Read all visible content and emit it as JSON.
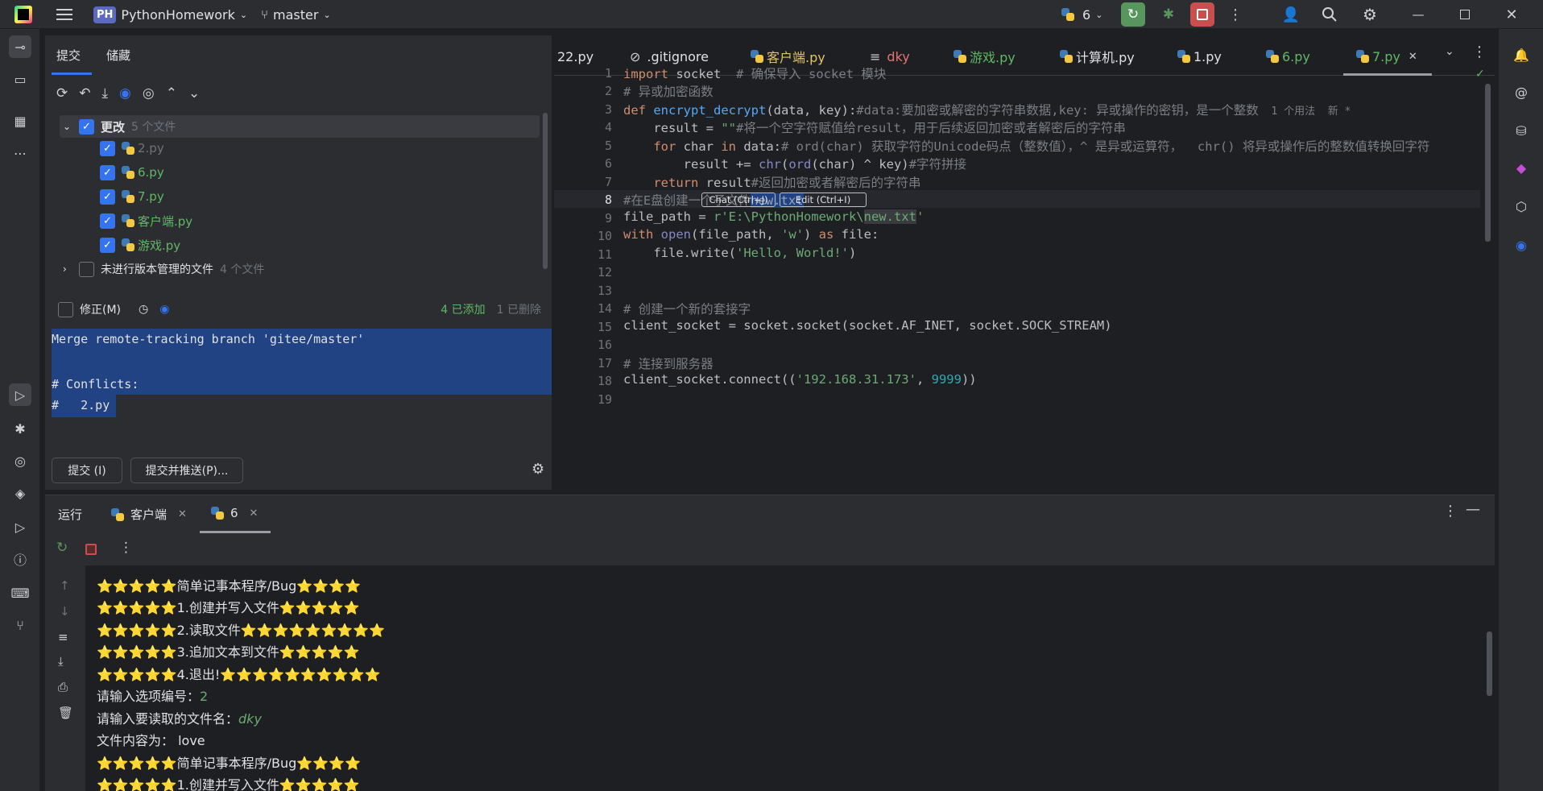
{
  "titlebar": {
    "project_badge": "PH",
    "project": "PythonHomework",
    "branch": "master",
    "run_count": "6"
  },
  "commit": {
    "tab_commit": "提交",
    "tab_stash": "储藏",
    "changes_label": "更改",
    "changes_count": "5 个文件",
    "files": [
      "2.py",
      "6.py",
      "7.py",
      "客户端.py",
      "游戏.py"
    ],
    "unversioned_label": "未进行版本管理的文件",
    "unversioned_count": "4 个文件",
    "amend": "修正(M)",
    "added": "4 已添加",
    "deleted": "1 已删除",
    "message": [
      "Merge remote-tracking branch 'gitee/master'",
      "",
      "# Conflicts:",
      "#   2.py"
    ],
    "commit_btn": "提交 (I)",
    "commit_push_btn": "提交并推送(P)..."
  },
  "editor": {
    "tabs": [
      "22.py",
      ".gitignore",
      "客户端.py",
      "dky",
      "游戏.py",
      "计算机.py",
      "1.py",
      "6.py",
      "7.py"
    ],
    "active_tab": "7.py",
    "line_numbers": [
      "1",
      "2",
      "3",
      "4",
      "5",
      "6",
      "7",
      "8",
      "9",
      "10",
      "11",
      "12",
      "13",
      "14",
      "15",
      "16",
      "17",
      "18",
      "19"
    ],
    "code": {
      "l1a": "import",
      "l1b": " socket  ",
      "l1c": "# 确保导入 socket 模块",
      "l2": "# 异或加密函数",
      "l3a": "def ",
      "l3b": "encrypt_decrypt",
      "l3c": "(data, key):",
      "l3d": "#data:要加密或解密的字符串数据,key: 异或操作的密钥，是一个整数",
      "l3e": "  1 个用法  新 *",
      "l4a": "    result = ",
      "l4b": "\"\"",
      "l4c": "#将一个空字符赋值给result，用于后续返回加密或者解密后的字符串",
      "l5a": "    for ",
      "l5b": "char ",
      "l5c": "in ",
      "l5d": "data:",
      "l5e": "# ord(char) 获取字符的Unicode码点（整数值），^ 是异或运算符，  chr() 将异或操作后的整数值转换回字符",
      "l6a": "        result += ",
      "l6b": "chr",
      "l6c": "(",
      "l6d": "ord",
      "l6e": "(char) ^ key)",
      "l6f": "#字符拼接",
      "l7a": "    return ",
      "l7b": "result",
      "l7c": "#返回加密或者解密后的字符串",
      "l8a": "#在E盘创建一个子文件",
      "l8b": "new.txt",
      "l8chat": "Chat (Ctrl+J)",
      "l8edit": "Edit (Ctrl+I)",
      "l9a": "file_path = ",
      "l9b": "r'E:\\PythonHomework\\",
      "l9c": "new.txt",
      "l9d": "'",
      "l10a": "with ",
      "l10b": "open",
      "l10c": "(file_path, ",
      "l10d": "'w'",
      "l10e": ") ",
      "l10f": "as ",
      "l10g": "file:",
      "l11a": "    file.write(",
      "l11b": "'Hello, World!'",
      "l11c": ")",
      "l14": "# 创建一个新的套接字",
      "l15": "client_socket = socket.socket(socket.AF_INET, socket.SOCK_STREAM)",
      "l17": "# 连接到服务器",
      "l18a": "client_socket.connect((",
      "l18b": "'192.168.31.173'",
      "l18c": ", ",
      "l18d": "9999",
      "l18e": "))"
    }
  },
  "run": {
    "tab_run": "运行",
    "tab_client": "客户端",
    "tab_6": "6",
    "lines": [
      {
        "pre": "⭐⭐⭐⭐⭐",
        "text": "简单记事本程序/Bug",
        "post": "⭐⭐⭐⭐"
      },
      {
        "pre": "⭐⭐⭐⭐⭐",
        "text": "1.创建并写入文件",
        "post": "⭐⭐⭐⭐⭐"
      },
      {
        "pre": "⭐⭐⭐⭐⭐",
        "text": "2.读取文件",
        "post": "⭐⭐⭐⭐⭐⭐⭐⭐⭐"
      },
      {
        "pre": "⭐⭐⭐⭐⭐",
        "text": "3.追加文本到文件",
        "post": "⭐⭐⭐⭐⭐"
      },
      {
        "pre": "⭐⭐⭐⭐⭐",
        "text": "4.退出!",
        "post": "⭐⭐⭐⭐⭐⭐⭐⭐⭐⭐"
      }
    ],
    "prompt1": "请输入选项编号：",
    "input1": "2",
    "prompt2": "请输入要读取的文件名：",
    "input2": "dky",
    "content": "文件内容为： love",
    "line_after": {
      "pre": "⭐⭐⭐⭐⭐",
      "text": "简单记事本程序/Bug",
      "post": "⭐⭐⭐⭐"
    },
    "line_cut": {
      "pre": "⭐⭐⭐⭐⭐",
      "text": "1.创建并写入文件",
      "post": "⭐⭐⭐⭐⭐"
    }
  },
  "colors": {
    "accent": "#3574f0",
    "selection": "#214283",
    "bg": "#1e1f22",
    "panel": "#2b2d30"
  }
}
